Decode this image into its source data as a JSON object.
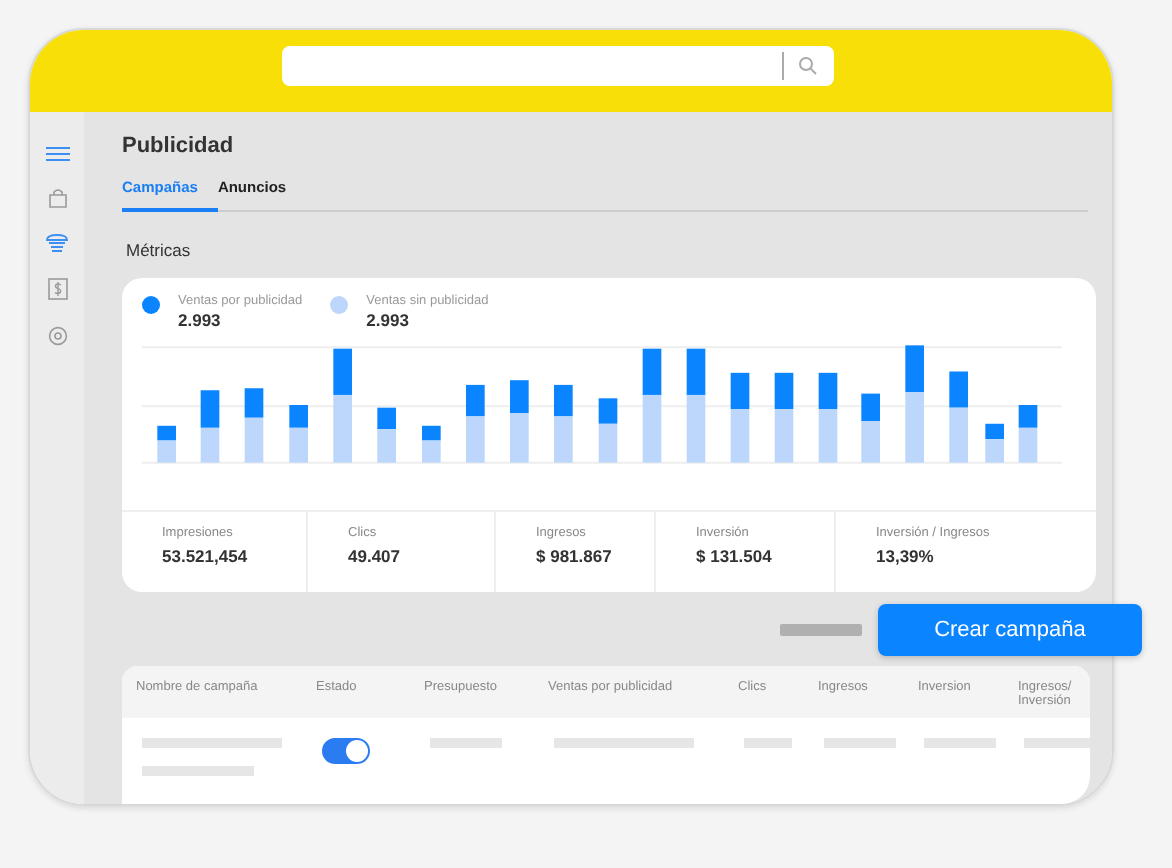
{
  "page": {
    "title": "Publicidad"
  },
  "tabs": [
    {
      "label": "Campañas",
      "selected": true
    },
    {
      "label": "Anuncios",
      "selected": false
    }
  ],
  "section_title": "Métricas",
  "legend": [
    {
      "label": "Ventas por publicidad",
      "value": "2.993",
      "color": "#0a84ff"
    },
    {
      "label": "Ventas sin publicidad",
      "value": "2.993",
      "color": "#bcd7fb"
    }
  ],
  "metrics": [
    {
      "label": "Impresiones",
      "value": "53.521,454"
    },
    {
      "label": "Clics",
      "value": "49.407"
    },
    {
      "label": "Ingresos",
      "value": "$ 981.867"
    },
    {
      "label": "Inversión",
      "value": "$ 131.504"
    },
    {
      "label": "Inversión / Ingresos",
      "value": "13,39%"
    }
  ],
  "create_button": "Crear campaña",
  "table": {
    "columns": [
      "Nombre de campaña",
      "Estado",
      "Presupuesto",
      "Ventas por publicidad",
      "Clics",
      "Ingresos",
      "Inversion",
      "Ingresos/ Inversión"
    ],
    "rows": [
      {
        "on": true
      }
    ]
  }
}
